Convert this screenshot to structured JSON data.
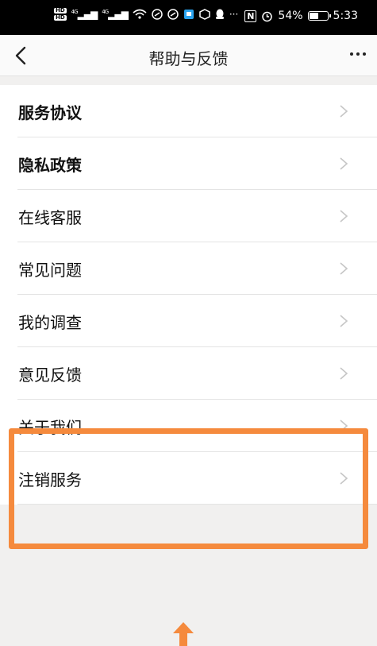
{
  "status_bar": {
    "hd1": "HD",
    "hd2": "HD",
    "net1": "4G",
    "net2": "4G",
    "more": "···",
    "nfc": "N",
    "battery": "54%",
    "battery_level": 0.54,
    "time": "5:33"
  },
  "nav": {
    "title": "帮助与反馈"
  },
  "menu": {
    "items": [
      {
        "label": "服务协议"
      },
      {
        "label": "隐私政策"
      },
      {
        "label": "在线客服"
      },
      {
        "label": "常见问题"
      },
      {
        "label": "我的调查"
      },
      {
        "label": "意见反馈"
      },
      {
        "label": "关于我们"
      },
      {
        "label": "注销服务"
      }
    ]
  },
  "colors": {
    "highlight": "#f58a3d",
    "background": "#f1f0ef"
  }
}
